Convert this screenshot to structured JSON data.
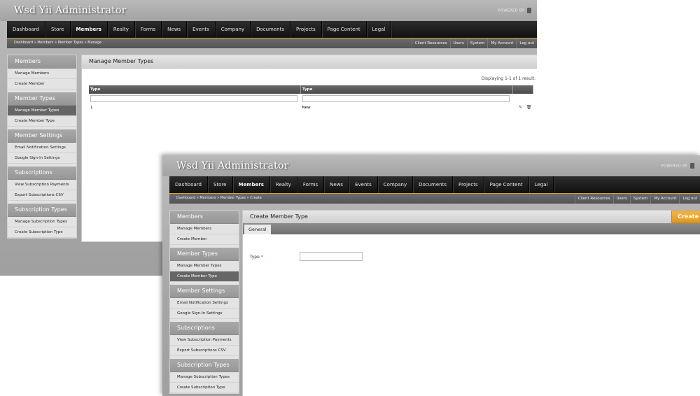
{
  "app": {
    "title": "Wsd Yii Administrator",
    "powered_by": "POWERED BY"
  },
  "main_nav": [
    "Dashboard",
    "Store",
    "Members",
    "Realty",
    "Forms",
    "News",
    "Events",
    "Company",
    "Documents",
    "Projects",
    "Page Content",
    "Legal"
  ],
  "main_nav_active": "Members",
  "top_links": [
    "Client Resources",
    "Users",
    "System",
    "My Account",
    "Log out"
  ],
  "sidebar": {
    "sections": [
      {
        "title": "Members",
        "items": [
          "Manage Members",
          "Create Member"
        ]
      },
      {
        "title": "Member Types",
        "items": [
          "Manage Member Types",
          "Create Member Type"
        ]
      },
      {
        "title": "Member Settings",
        "items": [
          "Email Notification Settings",
          "Google Sign-In Settings"
        ]
      },
      {
        "title": "Subscriptions",
        "items": [
          "View Subscription Payments",
          "Export Subscriptions CSV"
        ]
      },
      {
        "title": "Subscription Types",
        "items": [
          "Manage Subscription Types",
          "Create Subscription Type"
        ]
      }
    ]
  },
  "window_manage": {
    "breadcrumb": "Dashboard » Members » Member Types » Manage",
    "panel_title": "Manage Member Types",
    "active_sidebar_item": "Manage Member Types",
    "summary": "Displaying 1-1 of 1 result.",
    "grid": {
      "headers": [
        "Type",
        "Type"
      ],
      "rows": [
        {
          "id": "1",
          "name": "New"
        }
      ],
      "actions": [
        "edit-icon",
        "delete-icon"
      ]
    }
  },
  "window_create": {
    "breadcrumb": "Dashboard » Members » Member Types » Create",
    "panel_title": "Create Member Type",
    "active_sidebar_item": "Create Member Type",
    "create_button": "Create",
    "tab": "General",
    "field_label": "Type",
    "required_mark": "*",
    "field_value": ""
  },
  "colors": {
    "accent": "#e49619",
    "nav_bg": "#1a1a1a",
    "nav_border": "#d7a42b",
    "sidebar_active": "#666666"
  }
}
